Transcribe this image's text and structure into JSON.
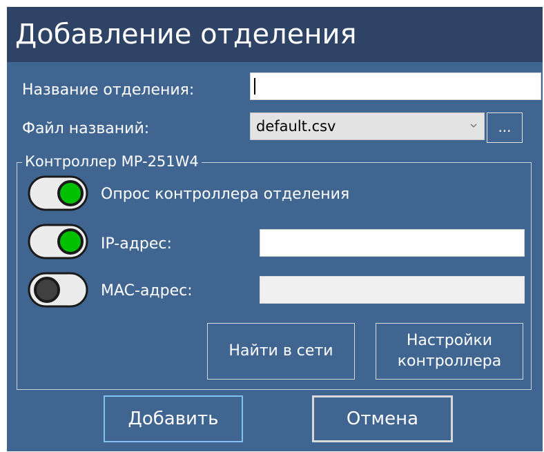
{
  "window": {
    "title": "Добавление отделения"
  },
  "form": {
    "department_name_label": "Название отделения:",
    "department_name_value": "",
    "names_file_label": "Файл названий:",
    "names_file_value": "default.csv",
    "browse_button_label": "..."
  },
  "controller": {
    "group_title": "Контроллер MP-251W4",
    "poll_toggle": {
      "label": "Опрос контроллера отделения",
      "on": true
    },
    "ip_toggle": {
      "label": "IP-адрес:",
      "on": true,
      "value": ""
    },
    "mac_toggle": {
      "label": "MAC-адрес:",
      "on": false,
      "value": ""
    },
    "find_button_label": "Найти в сети",
    "settings_button_label": "Настройки\nконтроллера"
  },
  "footer": {
    "add_button_label": "Добавить",
    "cancel_button_label": "Отмена"
  },
  "colors": {
    "dialog_background": "#3f6590",
    "title_bar": "#2e4366",
    "toggle_on": "#00c000",
    "toggle_off": "#404040",
    "focus_border": "#7fc3f0"
  }
}
